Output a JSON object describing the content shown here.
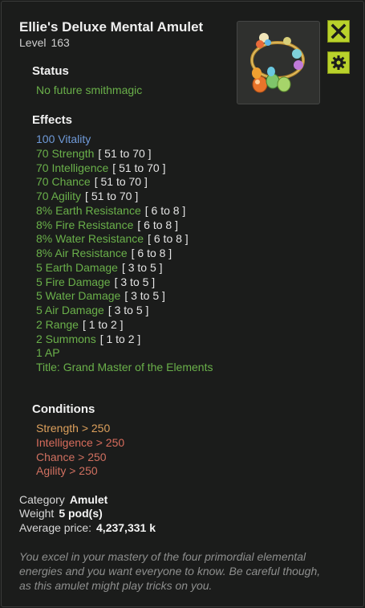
{
  "item": {
    "name": "Ellie's Deluxe Mental Amulet",
    "level_label": "Level",
    "level_value": "163"
  },
  "buttons": {
    "close_icon": "close-icon",
    "settings_icon": "gear-icon",
    "accent_color": "#b9d22b"
  },
  "status": {
    "heading": "Status",
    "text": "No future smithmagic"
  },
  "effects": {
    "heading": "Effects",
    "items": [
      {
        "stat": "100 Vitality",
        "range": ""
      },
      {
        "stat": "70 Strength",
        "range": "[ 51 to 70 ]"
      },
      {
        "stat": "70 Intelligence",
        "range": "[ 51 to 70 ]"
      },
      {
        "stat": "70 Chance",
        "range": "[ 51 to 70 ]"
      },
      {
        "stat": "70 Agility",
        "range": "[ 51 to 70 ]"
      },
      {
        "stat": "8% Earth Resistance",
        "range": "[ 6 to 8 ]"
      },
      {
        "stat": "8% Fire Resistance",
        "range": "[ 6 to 8 ]"
      },
      {
        "stat": "8% Water Resistance",
        "range": "[ 6 to 8 ]"
      },
      {
        "stat": "8% Air Resistance",
        "range": "[ 6 to 8 ]"
      },
      {
        "stat": "5 Earth Damage",
        "range": "[ 3 to 5 ]"
      },
      {
        "stat": "5 Fire Damage",
        "range": "[ 3 to 5 ]"
      },
      {
        "stat": "5 Water Damage",
        "range": "[ 3 to 5 ]"
      },
      {
        "stat": "5 Air Damage",
        "range": "[ 3 to 5 ]"
      },
      {
        "stat": "2 Range",
        "range": "[ 1 to 2 ]"
      },
      {
        "stat": "2 Summons",
        "range": "[ 1 to 2 ]"
      },
      {
        "stat": "1 AP",
        "range": ""
      },
      {
        "stat": "Title: Grand Master of the Elements",
        "range": ""
      }
    ]
  },
  "conditions": {
    "heading": "Conditions",
    "items": [
      "Strength > 250",
      "Intelligence > 250",
      "Chance > 250",
      "Agility > 250"
    ]
  },
  "meta": {
    "category_label": "Category",
    "category_value": "Amulet",
    "weight_label": "Weight",
    "weight_value": "5 pod(s)",
    "price_label": "Average price:",
    "price_value": "4,237,331 k"
  },
  "description": "You excel in your mastery of the four primordial elemental energies and you want everyone to know. Be careful though, as this amulet might play tricks on you.",
  "colors": {
    "effect_green": "#6ab04a",
    "vitality_blue": "#6f9ad8",
    "condition_orange": "#dca05c",
    "condition_red": "#d86c5c"
  }
}
